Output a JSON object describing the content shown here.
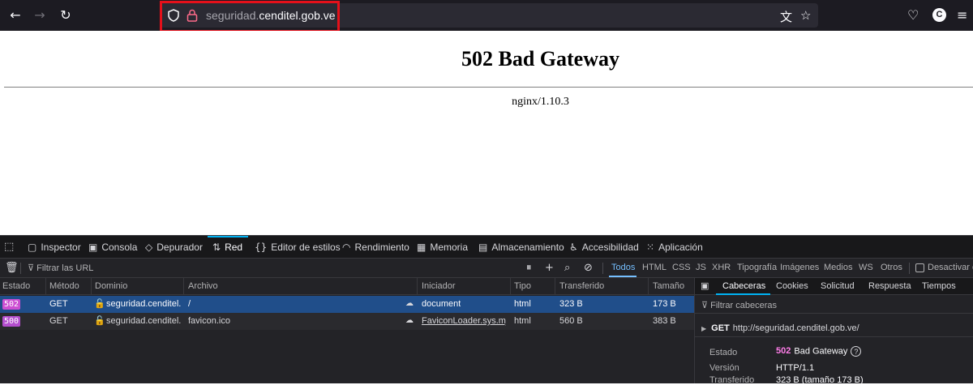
{
  "browser": {
    "url_subdomain": "seguridad.",
    "url_domain": "cenditel.gob.ve",
    "account_initial": "C",
    "icons": [
      "back-icon",
      "forward-icon",
      "reload-icon",
      "shield-icon",
      "lock-icon",
      "translate-icon",
      "bookmark-star-icon",
      "pocket-icon",
      "account-icon"
    ],
    "highlight_color": "#e5101a"
  },
  "page": {
    "heading": "502 Bad Gateway",
    "server": "nginx/1.10.3"
  },
  "devtools": {
    "tabs": [
      "Inspector",
      "Consola",
      "Depurador",
      "Red",
      "Editor de estilos",
      "Rendimiento",
      "Memoria",
      "Almacenamiento",
      "Accesibilidad",
      "Aplicación"
    ],
    "active_tab": "Red",
    "filter_placeholder": "Filtrar las URL",
    "type_filters": [
      "Todos",
      "HTML",
      "CSS",
      "JS",
      "XHR",
      "Tipografía",
      "Imágenes",
      "Medios",
      "WS",
      "Otros"
    ],
    "active_filter": "Todos",
    "disable_cache_label": "Desactivar ca",
    "columns": [
      "Estado",
      "Método",
      "Dominio",
      "Archivo",
      "Iniciador",
      "Tipo",
      "Transferido",
      "Tamaño"
    ],
    "requests": [
      {
        "status": "502",
        "method": "GET",
        "domain": "seguridad.cenditel.g...",
        "file": "/",
        "initiator": "document",
        "type": "html",
        "transferred": "323 B",
        "size": "173 B",
        "selected": true
      },
      {
        "status": "500",
        "method": "GET",
        "domain": "seguridad.cenditel.g...",
        "file": "favicon.ico",
        "initiator": "FaviconLoader.sys.mjs:...",
        "type": "html",
        "transferred": "560 B",
        "size": "383 B",
        "selected": false
      }
    ],
    "side_tabs": [
      "Cabeceras",
      "Cookies",
      "Solicitud",
      "Respuesta",
      "Tiempos"
    ],
    "active_side_tab": "Cabeceras",
    "side_filter_placeholder": "Filtrar cabeceras",
    "request_method": "GET",
    "request_url": "http://seguridad.cenditel.gob.ve/",
    "details": {
      "estado_label": "Estado",
      "estado_code": "502",
      "estado_text": "Bad Gateway",
      "version_label": "Versión",
      "version_value": "HTTP/1.1",
      "transferido_label": "Transferido",
      "transferido_value": "323 B (tamaño 173 B)"
    }
  }
}
